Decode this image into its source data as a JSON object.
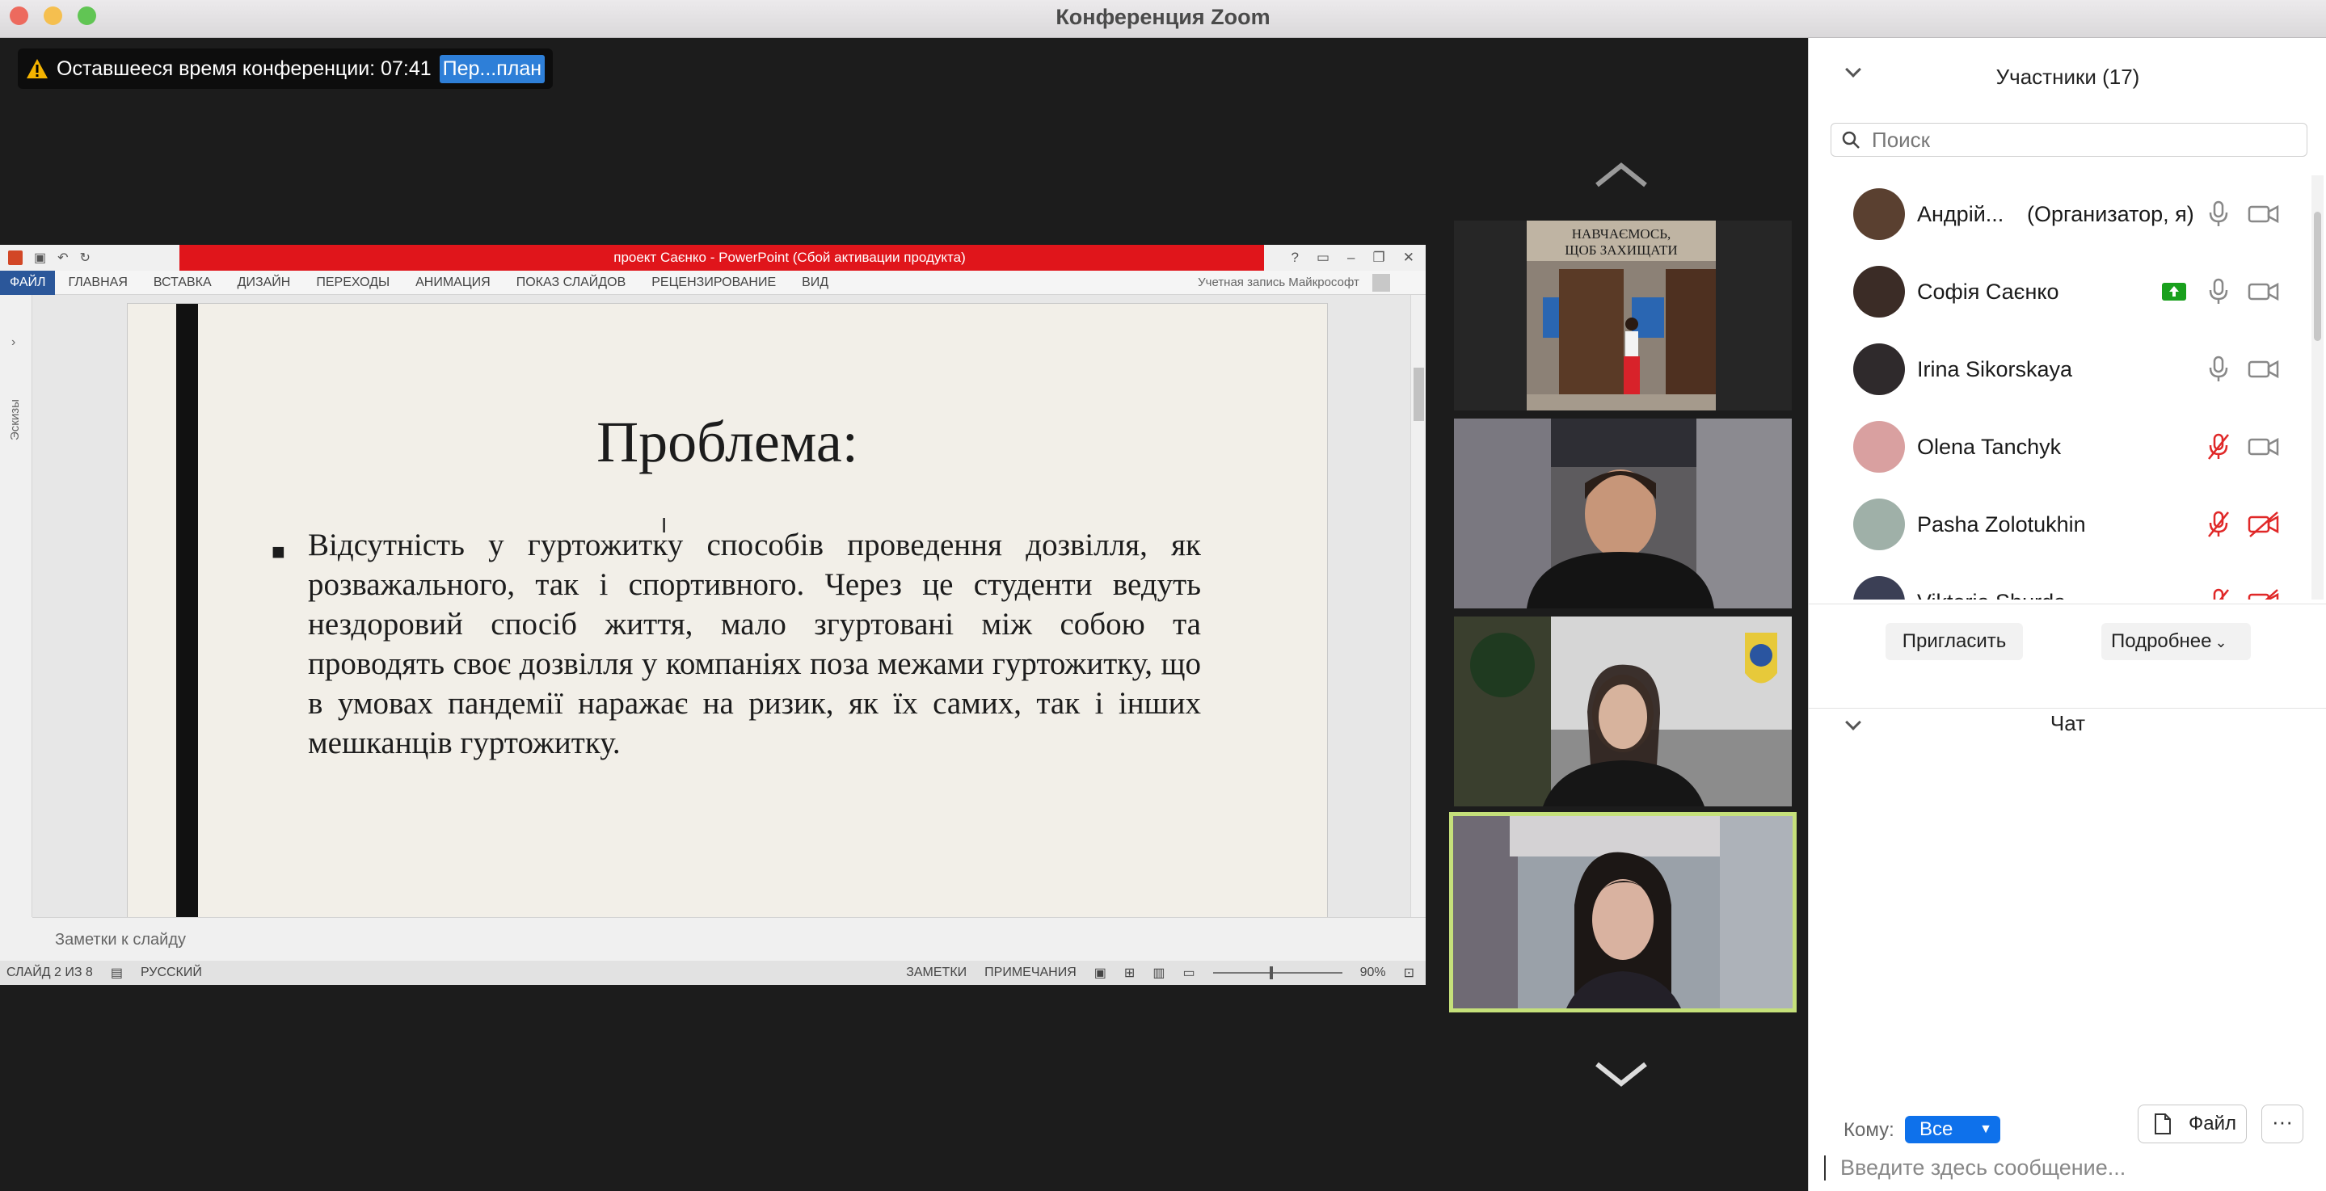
{
  "window": {
    "title": "Конференция Zoom"
  },
  "timer": {
    "label": "Оставшееся время конференции: 07:41",
    "button": "Пер...план"
  },
  "ppt": {
    "title": "проект Саєнко -  PowerPoint (Сбой активации продукта)",
    "tabs": [
      "ФАЙЛ",
      "ГЛАВНАЯ",
      "ВСТАВКА",
      "ДИЗАЙН",
      "ПЕРЕХОДЫ",
      "АНИМАЦИЯ",
      "ПОКАЗ СЛАЙДОВ",
      "РЕЦЕНЗИРОВАНИЕ",
      "ВИД"
    ],
    "account": "Учетная запись Майкрософт",
    "thumbs_label": "Эскизы",
    "slide_title": "Проблема:",
    "slide_text": "Відсутність у гуртожитку способів проведення дозвілля, як розважального, так і спортивного. Через це студенти ведуть нездоровий спосіб життя, мало згуртовані між собою та проводять своє дозвілля у компаніях поза межами гуртожитку, що в умовах пандемії наражає на ризик, як їх самих, так і інших мешканців гуртожитку.",
    "notes_placeholder": "Заметки к слайду",
    "status": {
      "slide": "СЛАЙД 2 ИЗ 8",
      "lang": "РУССКИЙ",
      "notes": "ЗАМЕТКИ",
      "comments": "ПРИМЕЧАНИЯ",
      "zoom": "90%"
    },
    "banner_text": "НАВЧАЄМОСЬ, ЩОБ ЗАХИЩАТИ"
  },
  "participants": {
    "header": "Участники (17)",
    "search_placeholder": "Поиск",
    "list": [
      {
        "name": "Андрій...",
        "role": "(Организатор, я)",
        "mic": "on",
        "cam": "on",
        "sharing": false,
        "avatar_color": "#5a4030"
      },
      {
        "name": "Софія Саєнко",
        "role": "",
        "mic": "on",
        "cam": "on",
        "sharing": true,
        "avatar_color": "#3b2c26"
      },
      {
        "name": "Irina Sikorskaya",
        "role": "",
        "mic": "on",
        "cam": "on",
        "sharing": false,
        "avatar_color": "#2f2a2c"
      },
      {
        "name": "Olena Tanchyk",
        "role": "",
        "mic": "muted",
        "cam": "on",
        "sharing": false,
        "avatar_color": "#d9a0a0"
      },
      {
        "name": "Pasha Zolotukhin",
        "role": "",
        "mic": "muted",
        "cam": "off",
        "sharing": false,
        "avatar_color": "#9fb0a8"
      },
      {
        "name": "Viktoria Shurda",
        "role": "",
        "mic": "muted",
        "cam": "off",
        "sharing": false,
        "avatar_color": "#3b3f55"
      }
    ],
    "invite": "Пригласить",
    "more": "Подробнее"
  },
  "chat": {
    "header": "Чат",
    "to_label": "Кому:",
    "to_value": "Все",
    "file": "Файл",
    "more": "···",
    "input_placeholder": "Введите здесь сообщение..."
  },
  "colors": {
    "accent": "#0e71eb",
    "active_speaker": "#c5e07a",
    "muted": "#e02828",
    "ppt_title_bg": "#e0151b"
  }
}
